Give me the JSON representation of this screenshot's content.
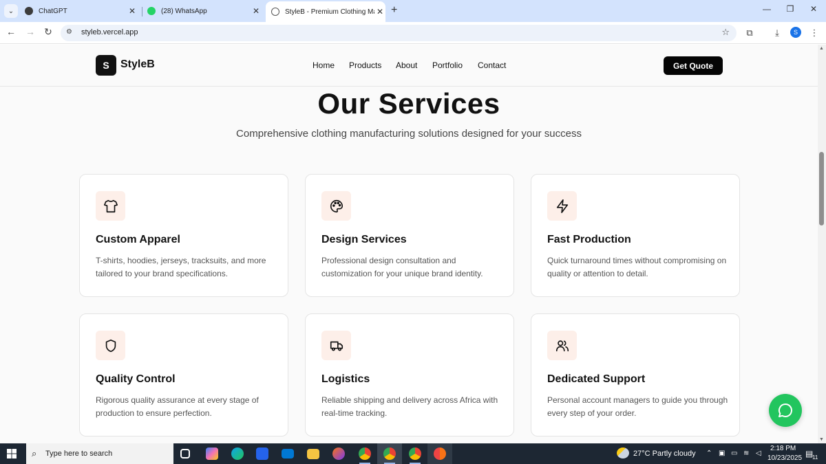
{
  "browser": {
    "tabs": [
      {
        "title": "ChatGPT",
        "active": false
      },
      {
        "title": "(28) WhatsApp",
        "active": false
      },
      {
        "title": "StyleB - Premium Clothing Manufacturer",
        "active": true
      }
    ],
    "url": "styleb.vercel.app",
    "profile_initial": "S"
  },
  "site": {
    "logo_letter": "S",
    "logo_text": "StyleB",
    "nav": [
      "Home",
      "Products",
      "About",
      "Portfolio",
      "Contact"
    ],
    "cta": "Get Quote"
  },
  "services": {
    "title": "Our Services",
    "subtitle": "Comprehensive clothing manufacturing solutions designed for your success",
    "items": [
      {
        "icon": "shirt-icon",
        "title": "Custom Apparel",
        "description": "T-shirts, hoodies, jerseys, tracksuits, and more tailored to your brand specifications."
      },
      {
        "icon": "palette-icon",
        "title": "Design Services",
        "description": "Professional design consultation and customization for your unique brand identity."
      },
      {
        "icon": "lightning-icon",
        "title": "Fast Production",
        "description": "Quick turnaround times without compromising on quality or attention to detail."
      },
      {
        "icon": "shield-icon",
        "title": "Quality Control",
        "description": "Rigorous quality assurance at every stage of production to ensure perfection."
      },
      {
        "icon": "truck-icon",
        "title": "Logistics",
        "description": "Reliable shipping and delivery across Africa with real-time tracking."
      },
      {
        "icon": "users-icon",
        "title": "Dedicated Support",
        "description": "Personal account managers to guide you through every step of your order."
      }
    ]
  },
  "taskbar": {
    "search_placeholder": "Type here to search",
    "weather": "27°C  Partly cloudy",
    "time": "2:18 PM",
    "date": "10/23/2025",
    "notification_count": "11"
  },
  "colors": {
    "accent_bg": "#fdefe9",
    "whatsapp_green": "#22c55e",
    "cta_bg": "#050505"
  }
}
